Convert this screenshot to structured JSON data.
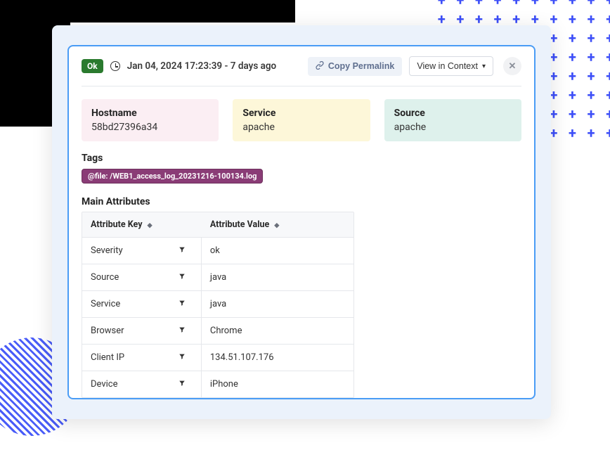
{
  "header": {
    "status": "Ok",
    "timestamp": "Jan 04, 2024 17:23:39 - 7 days ago",
    "copy_label": "Copy Permalink",
    "context_label": "View in Context"
  },
  "info": {
    "hostname_label": "Hostname",
    "hostname_value": "58bd27396a34",
    "service_label": "Service",
    "service_value": "apache",
    "source_label": "Source",
    "source_value": "apache"
  },
  "tags": {
    "title": "Tags",
    "items": [
      "@file: /WEB1_access_log_20231216-100134.log"
    ]
  },
  "attrs": {
    "title": "Main Attributes",
    "col_key": "Attribute Key",
    "col_value": "Attribute Value",
    "rows": [
      {
        "key": "Severity",
        "value": "ok"
      },
      {
        "key": "Source",
        "value": "java"
      },
      {
        "key": "Service",
        "value": "java"
      },
      {
        "key": "Browser",
        "value": "Chrome"
      },
      {
        "key": "Client IP",
        "value": "134.51.107.176"
      },
      {
        "key": "Device",
        "value": "iPhone"
      }
    ]
  }
}
